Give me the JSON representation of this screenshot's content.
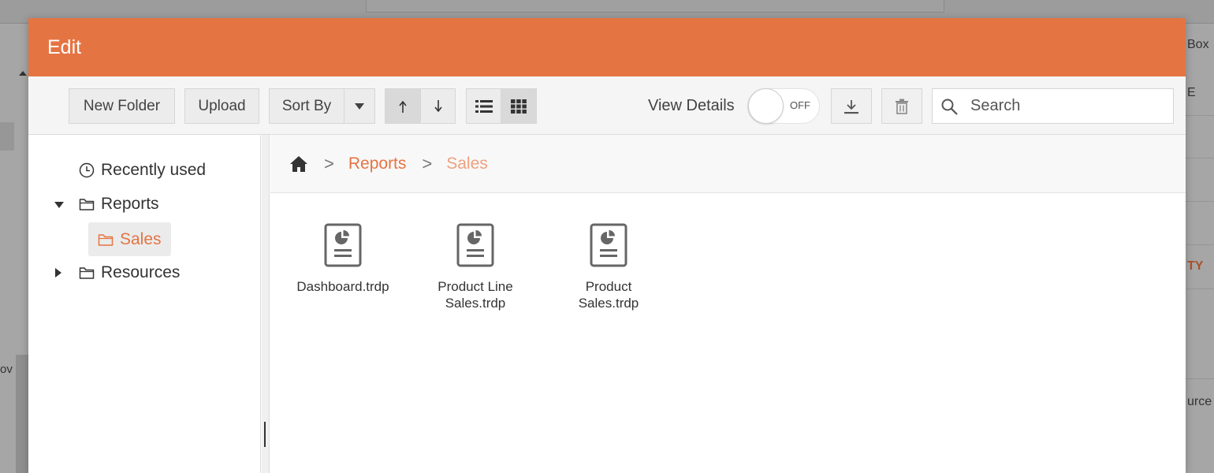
{
  "background": {
    "left_text": "ov",
    "right_texts": [
      "Box",
      "E",
      "TY",
      "urce"
    ]
  },
  "dialog": {
    "title": "Edit"
  },
  "toolbar": {
    "new_folder_label": "New Folder",
    "upload_label": "Upload",
    "sort_by_label": "Sort By",
    "sort_ascending_icon": "arrow-up-icon",
    "sort_descending_icon": "arrow-down-icon",
    "list_view_icon": "list-view-icon",
    "grid_view_icon": "grid-view-icon",
    "view_details_label": "View Details",
    "toggle_state": "OFF",
    "download_icon": "download-icon",
    "delete_icon": "trash-icon",
    "search_placeholder": "Search"
  },
  "navigation": {
    "items": [
      {
        "label": "Recently used",
        "icon": "clock-icon"
      },
      {
        "label": "Reports",
        "icon": "folder-icon",
        "expanded": true
      },
      {
        "label": "Sales",
        "icon": "folder-icon",
        "selected": true
      },
      {
        "label": "Resources",
        "icon": "folder-icon",
        "expanded": false
      }
    ]
  },
  "breadcrumb": {
    "home_icon": "home-icon",
    "items": [
      "Reports",
      "Sales"
    ]
  },
  "files": [
    {
      "name_line1": "Dashboard.trdp",
      "name_line2": ""
    },
    {
      "name_line1": "Product Line",
      "name_line2": "Sales.trdp"
    },
    {
      "name_line1": "Product",
      "name_line2": "Sales.trdp"
    }
  ],
  "colors": {
    "accent": "#e57443",
    "accent_light": "#f0a07e"
  }
}
